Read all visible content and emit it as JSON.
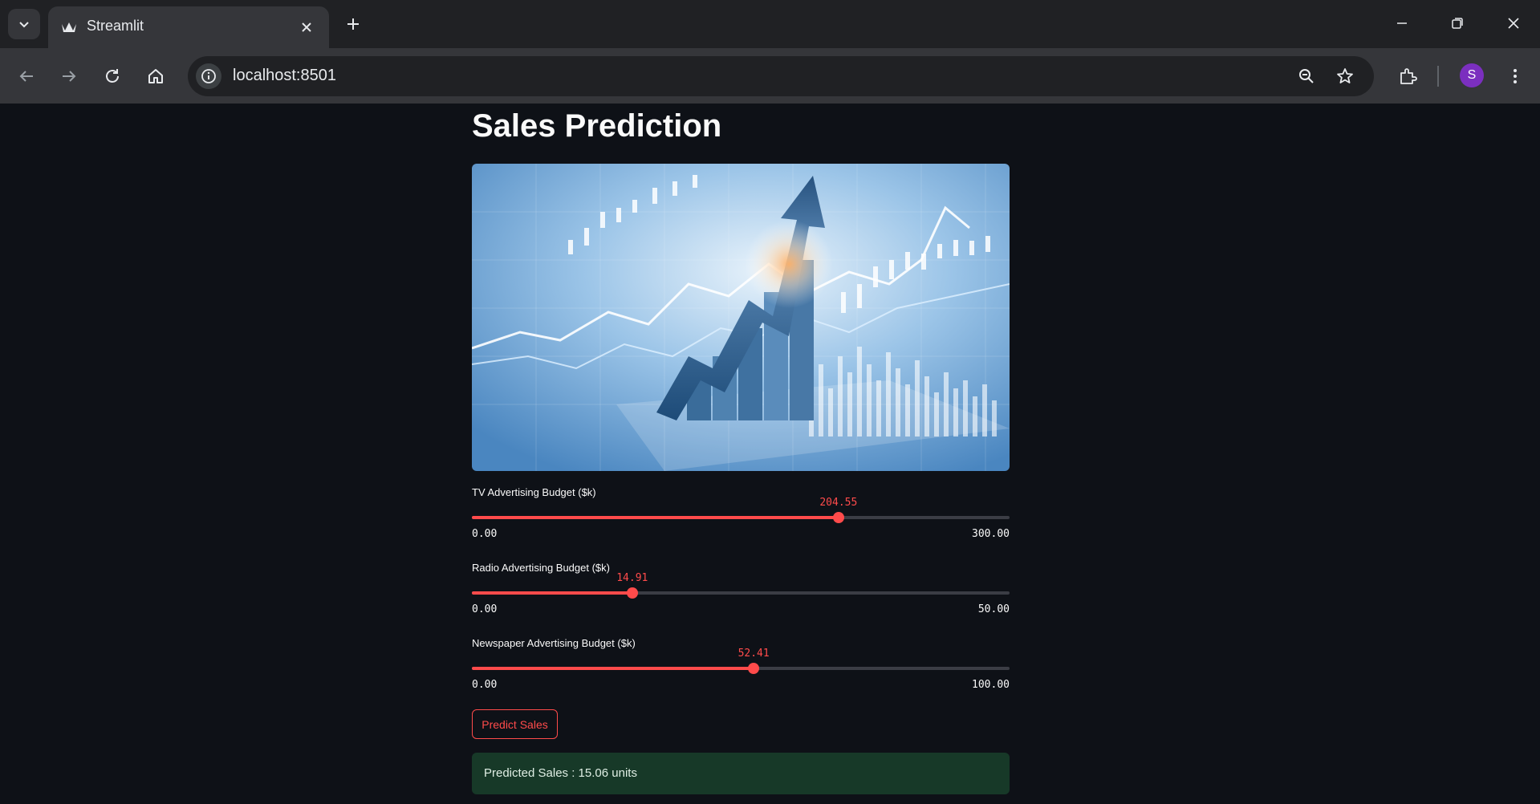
{
  "browser": {
    "tab_title": "Streamlit",
    "url": "localhost:8501",
    "profile_initial": "S",
    "icons": [
      "tab-search-icon",
      "close-icon",
      "plus-icon",
      "back-icon",
      "forward-icon",
      "reload-icon",
      "home-icon",
      "info-icon",
      "zoom-icon",
      "star-icon",
      "extensions-icon",
      "more-icon",
      "minimize-icon",
      "restore-icon",
      "window-close-icon"
    ]
  },
  "page": {
    "title": "Sales Prediction",
    "accent_color": "#ff4b4b",
    "background_color": "#0e1117"
  },
  "sliders": [
    {
      "label": "TV Advertising Budget ($k)",
      "value": 204.55,
      "value_text": "204.55",
      "min": 0,
      "max": 300,
      "min_text": "0.00",
      "max_text": "300.00"
    },
    {
      "label": "Radio Advertising Budget ($k)",
      "value": 14.91,
      "value_text": "14.91",
      "min": 0,
      "max": 50,
      "min_text": "0.00",
      "max_text": "50.00"
    },
    {
      "label": "Newspaper Advertising Budget ($k)",
      "value": 52.41,
      "value_text": "52.41",
      "min": 0,
      "max": 100,
      "min_text": "0.00",
      "max_text": "100.00"
    }
  ],
  "predict_button": {
    "label": "Predict Sales"
  },
  "result": {
    "text": "Predicted Sales : 15.06 units",
    "color": "#173928"
  }
}
